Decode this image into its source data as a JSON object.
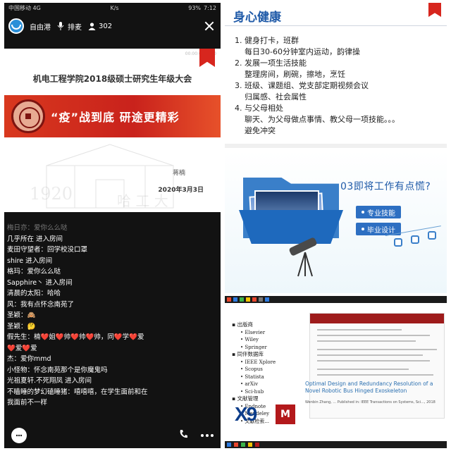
{
  "left": {
    "status": {
      "carrier": "中国移动 4G",
      "network": "K/s",
      "battery": "93%",
      "time": "7:12"
    },
    "topbar": {
      "host": "自由港",
      "mic_label": "排麦",
      "viewers": "302"
    },
    "slide": {
      "timestamp": "00:00:00/2020",
      "title": "机电工程学院2018级硕士研究生年级大会",
      "slogan": "“疫”战到底  研途更精彩",
      "presenter": "蒋楠",
      "date": "2020年3月3日",
      "bg_year": "1920",
      "bg_text": "哈 工 大"
    },
    "chat": [
      "梅日亦：爱你么么哒",
      "几乎所在 进入房间",
      "麦田守望者：回学校没口罩",
      "shire 进入房间",
      "格玛：爱你么么哒",
      "Sapphire丶 进入房间",
      "清晨的太阳：哈哈",
      "风：我有点怀念南苑了",
      "圣颖：🙈",
      "圣颖：🤔",
      "假先生：楠❤️姐❤️帅❤️帅❤️帅，同❤️学❤️爱",
      "❤️爱❤️爱",
      "杰：爱你mmd",
      "小怪物：怀念南苑那个是你魔鬼吗",
      "光祖夏轩.不死翔凤 进入房间",
      "不瞌睡的梦幻磕睡猪：嘻嘻嘻，在学生面前和在",
      "我面前不一样"
    ]
  },
  "right_top": {
    "title": "身心健康",
    "items": [
      {
        "head": "1.  健身打卡，班群",
        "sub": "每日30-60分钟室内运动，韵律操"
      },
      {
        "head": "2.  发展一项生活技能",
        "sub": "整理房间，刷碗，擦地，烹饪"
      },
      {
        "head": "3.  班级、课题组、党支部定期视频会议",
        "sub": "归属感、社会属性"
      },
      {
        "head": "4.  与父母相处",
        "sub": "聊天、为父母做点事情、教父母一项技能。。。"
      },
      {
        "head": "",
        "sub": "避免冲突"
      }
    ]
  },
  "right_middle": {
    "heading": "03即将工作有点慌?",
    "tags": [
      "专业技能",
      "毕业设计"
    ]
  },
  "right_bottom": {
    "categories": [
      {
        "name": "出版商",
        "items": [
          "Elsevier",
          "Wiley",
          "Springer"
        ]
      },
      {
        "name": "同伴数据库",
        "items": [
          "IEEE Xplore",
          "Scopus",
          "Statista",
          "arXiv",
          "Sci-hub"
        ]
      },
      {
        "name": "文献管理",
        "items": [
          "Endnote",
          "Mendeley",
          "文献检索..."
        ]
      }
    ],
    "paper_title": "Optimal Design and Redundancy Resolution of a Novel Robotic Bus Hinged Exoskeleton",
    "paper_meta": "Wenbin Zhang, ... Published in: IEEE Transactions on Systems, Sci..., 2018",
    "logo_x9": "X9",
    "logo_md": "M"
  },
  "colors": {
    "accent_red": "#d7261e",
    "accent_blue": "#1f5aa8",
    "phone_bg": "#121212"
  },
  "icons": {
    "close": "close-icon",
    "mic": "mic-icon",
    "viewers": "person-icon",
    "chat": "chat-icon",
    "phone": "phone-icon",
    "more": "more-icon"
  }
}
